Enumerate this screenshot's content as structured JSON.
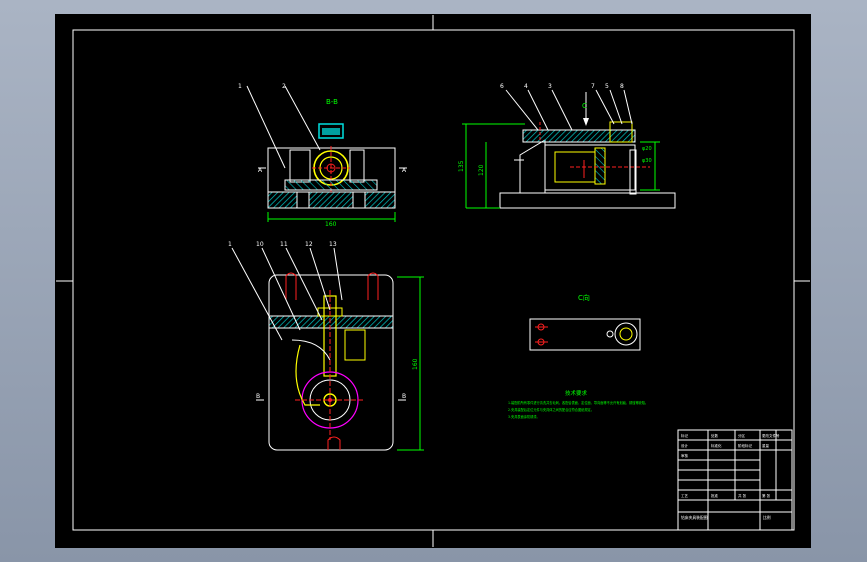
{
  "drawing": {
    "views": {
      "top_front_label": "B-B",
      "top_side_label": "C",
      "small_view_label": "C向",
      "section_a_left": "A",
      "section_a_right": "A",
      "section_b_left": "B",
      "section_b_right": "B",
      "dim_width_top": "160",
      "dim_height_side_1": "135",
      "dim_height_side_2": "120",
      "dim_vertical_bottom": "160",
      "dim_side_1": "φ20",
      "dim_side_2": "φ30"
    },
    "balloons_top_left": [
      "1",
      "2"
    ],
    "balloons_side": [
      "6",
      "4",
      "3",
      "7",
      "5",
      "8"
    ],
    "balloons_bottom": [
      "1",
      "10",
      "11",
      "12",
      "13"
    ],
    "notes": {
      "title": "技术要求",
      "lines": [
        "1.装配前所有零件进行清洗并去毛刺，各配合表面、定位面、导向面等不允许有划痕、锈蚀等缺陷。",
        "2.夹具装配后定位元件与夹具体之间的配合应符合图纸规定。",
        "3.夹具表面涂防锈漆。"
      ]
    },
    "title_block": {
      "rows": [
        [
          "标记",
          "处数",
          "分区",
          "更改文件号"
        ],
        [
          "设计",
          "标准化",
          "阶段标记",
          "重量"
        ],
        [
          "审核",
          "",
          "",
          ""
        ],
        [
          "工艺",
          "批准",
          "共 张",
          "第 张"
        ]
      ],
      "bottom_left": "钻床夹具装配图",
      "bottom_right": "比例"
    }
  },
  "colors": {
    "sheet": "#000000",
    "frame": "#ffffff",
    "outline": "#ffffff",
    "yellow": "#ffff00",
    "green": "#00ff00",
    "red": "#ff2020",
    "magenta": "#ff00ff",
    "hatch": "#00ffff",
    "dim": "#00ff00"
  }
}
